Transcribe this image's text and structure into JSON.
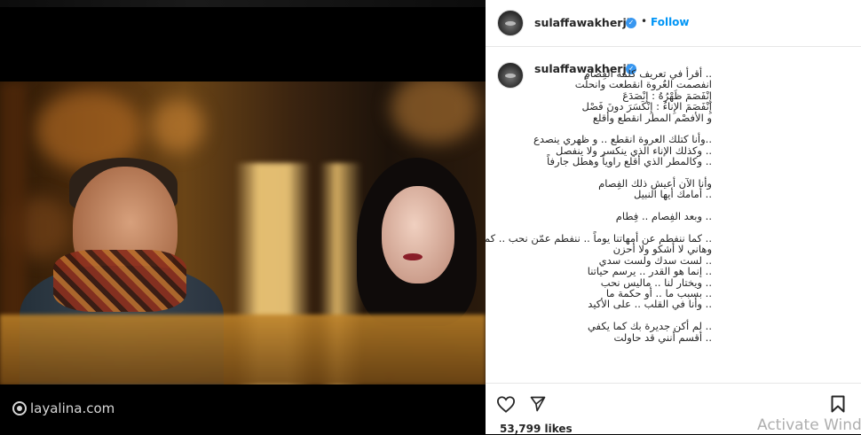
{
  "post": {
    "username": "sulaffawakherji",
    "verified_symbol": "✓",
    "dot": "•",
    "follow_label": "Follow",
    "likes": "53,799 likes",
    "caption_lines": [
      ".. أقرأ في تعريف كلمة الفِصام",
      "انفصمت العُروة انقطعت وانحلّت",
      "إِنْفَصَمَ ظَهْرُهُ : إِنْصَدَعَ",
      "إِنْفَصَمَ الإِناءُ : إِنْكَسَرَ دونَ فَصْل",
      "و الأفصْم المطر انقطع وأقلع",
      "",
      "..وأنا كتلك العروة انقطع .. و ظهري ينصدع",
      ".. وكذلك الإناء الذي ينكسر ولا ينفصل",
      ".. وكالمطر الذي أقلع راوياً وهطل جارفاً",
      "",
      "وأنا الآن أعيش ذلك الفِصام",
      ".. أمامك أيها النبيل",
      "",
      ".. وبعد الفِصام .. فِطام",
      "",
      ".. كما ننفطم عن أمهاتنا يوماً .. ننفطم عمّن نحب .. كما أنفطم عنك الآن",
      "وهاني لا أشكو ولا أحزن",
      ".. لست سدك ولست سدي",
      ".. إنما هو القدر .. يرسم حياتنا",
      ".. ويختار لنا .. ماليس نحب",
      ".. بسبب ما .. أو حكمة ما",
      ".. وأنا في القلب .. على الأكيد",
      "",
      ".. لم أكن جديرة بك كما يكفي",
      ".. أقسم أنني قد حاولت"
    ]
  },
  "watermark": {
    "text": "layalina.com"
  },
  "overlay": {
    "activate_text": "Activate Windo"
  },
  "icons": {
    "avatar": "profile-avatar",
    "verified": "verified-badge-icon",
    "like": "heart-icon",
    "share": "paper-plane-icon",
    "save": "bookmark-icon",
    "watermark": "layalina-logo-icon"
  },
  "colors": {
    "follow": "#0095f6",
    "verified": "#3897f0",
    "text": "#262626"
  }
}
